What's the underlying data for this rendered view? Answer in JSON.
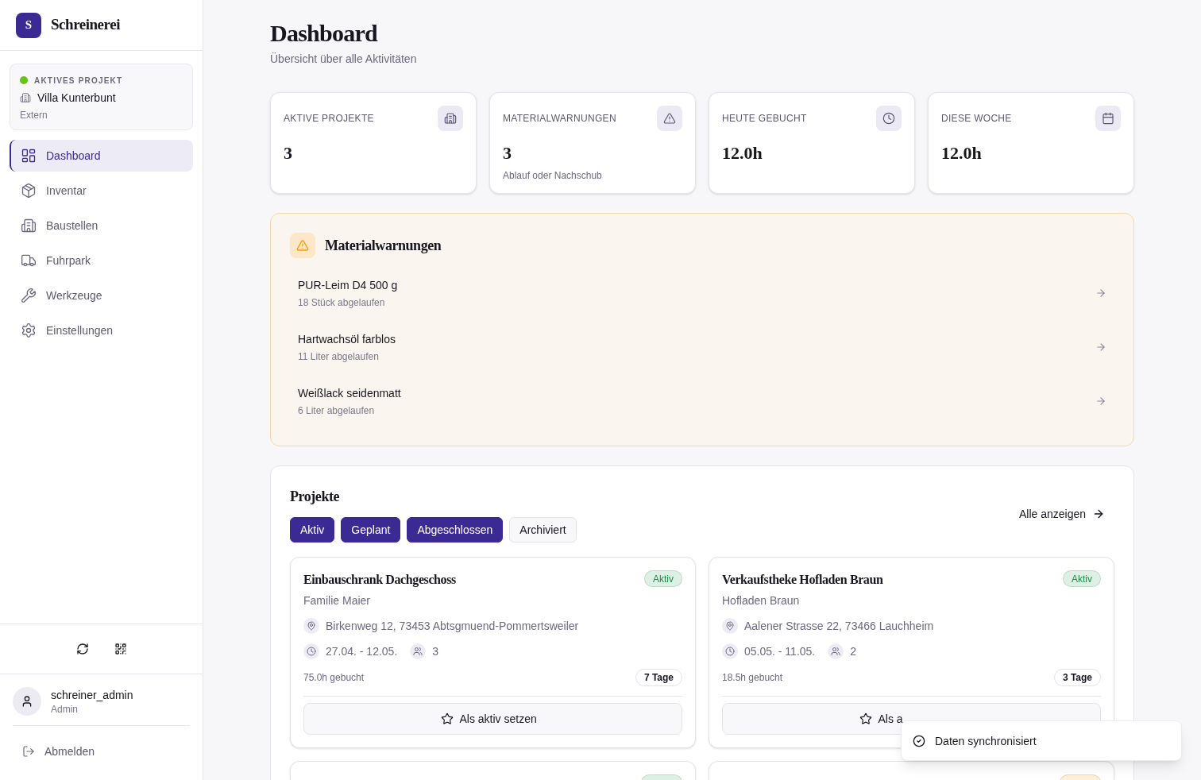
{
  "sidebar": {
    "logo_letter": "S",
    "app_name": "Schreinerei",
    "active_project": {
      "label": "AKTIVES PROJEKT",
      "name": "Villa Kunterbunt",
      "type": "Extern"
    },
    "nav_items": [
      {
        "label": "Dashboard",
        "selected": true
      },
      {
        "label": "Inventar",
        "selected": false
      },
      {
        "label": "Baustellen",
        "selected": false
      },
      {
        "label": "Fuhrpark",
        "selected": false
      },
      {
        "label": "Werkzeuge",
        "selected": false
      },
      {
        "label": "Einstellungen",
        "selected": false
      }
    ],
    "user": {
      "name": "schreiner_admin",
      "role": "Admin"
    },
    "logout": "Abmelden"
  },
  "header": {
    "title": "Dashboard",
    "subtitle": "Übersicht über alle Aktivitäten"
  },
  "stats": [
    {
      "label": "AKTIVE PROJEKTE",
      "value": "3"
    },
    {
      "label": "MATERIALWARNUNGEN",
      "value": "3",
      "note": "Ablauf oder Nachschub"
    },
    {
      "label": "HEUTE GEBUCHT",
      "value": "12.0h"
    },
    {
      "label": "DIESE WOCHE",
      "value": "12.0h"
    }
  ],
  "warnings": {
    "title": "Materialwarnungen",
    "items": [
      {
        "name": "PUR-Leim D4 500 g",
        "detail": "18 Stück abgelaufen"
      },
      {
        "name": "Hartwachsöl farblos",
        "detail": "11 Liter abgelaufen"
      },
      {
        "name": "Weißlack seidenmatt",
        "detail": "6 Liter abgelaufen"
      }
    ]
  },
  "projects": {
    "title": "Projekte",
    "filters": [
      {
        "label": "Aktiv",
        "selected": true
      },
      {
        "label": "Geplant",
        "selected": true
      },
      {
        "label": "Abgeschlossen",
        "selected": true
      },
      {
        "label": "Archiviert",
        "selected": false
      }
    ],
    "show_all": "Alle anzeigen",
    "cards": [
      {
        "title": "Einbauschrank Dachgeschoss",
        "status": "Aktiv",
        "color": "#dcf1e3",
        "client": "Familie Maier",
        "address": "Birkenweg 12, 73453 Abtsgmuend-Pommertsweiler",
        "dates": "27.04. - 12.05.",
        "workers": "3",
        "booked": "75.0h gebucht",
        "duration": "7 Tage",
        "action": "Als aktiv setzen"
      },
      {
        "title": "Verkaufstheke Hofladen Braun",
        "status": "Aktiv",
        "color": "#dcf1e3",
        "client": "Hofladen Braun",
        "address": "Aalener Strasse 22, 73466 Lauchheim",
        "dates": "05.05. - 11.05.",
        "workers": "2",
        "booked": "18.5h gebucht",
        "duration": "3 Tage",
        "action": "Als a"
      }
    ],
    "partial_cards": [
      {
        "color": "#dcf1e3"
      },
      {
        "color": "#fdf0d6"
      }
    ]
  },
  "toast": {
    "message": "Daten synchronisiert"
  }
}
